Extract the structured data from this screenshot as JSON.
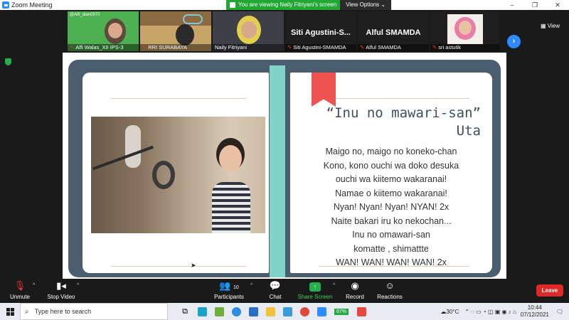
{
  "window": {
    "title": "Zoom Meeting",
    "controls": [
      "–",
      "❐",
      "✕"
    ]
  },
  "banner": {
    "message": "You are viewing Naily Fitriyani's screen",
    "options": "View Options ⌄"
  },
  "participants": [
    {
      "name": "Alfi Walas_XII IPS-3",
      "header": "@Alfi_dian0970",
      "muted": true
    },
    {
      "name": "RRI SURABAYA",
      "muted": true
    },
    {
      "name": "Naily Fitriyani",
      "muted": false
    },
    {
      "name": "Siti Agustini-SMAMDA",
      "display": "Siti Agustini-S...",
      "muted": true
    },
    {
      "name": "Alfuf SMAMDA",
      "display": "Alful SMAMDA",
      "label": "Alful SMAMDA",
      "muted": true
    },
    {
      "name": "sri astutik",
      "muted": true
    }
  ],
  "view_button": "View",
  "slide": {
    "title": "“Inu no mawari-san”",
    "subtitle": "Uta",
    "lyrics": [
      "Maigo no, maigo no koneko-chan",
      "Kono, kono ouchi wa doko desuka",
      "ouchi wa kiitemo wakaranai!",
      "Namae o kiitemo wakaranai!",
      "Nyan! Nyan! Nyan! NYAN! 2x",
      "Naite bakari iru ko nekochan...",
      "Inu no omawari-san",
      "komatte , shimattte",
      "WAN! WAN! WAN! WAN! 2x"
    ]
  },
  "toolbar": {
    "unmute": "Unmute",
    "stop_video": "Stop Video",
    "participants": "Participants",
    "participant_count": "10",
    "chat": "Chat",
    "share_screen": "Share Screen",
    "record": "Record",
    "reactions": "Reactions",
    "leave": "Leave"
  },
  "taskbar": {
    "search_placeholder": "Type here to search",
    "battery": "67%",
    "temperature": "30°C",
    "time": "10:44",
    "date": "07/12/2021"
  }
}
